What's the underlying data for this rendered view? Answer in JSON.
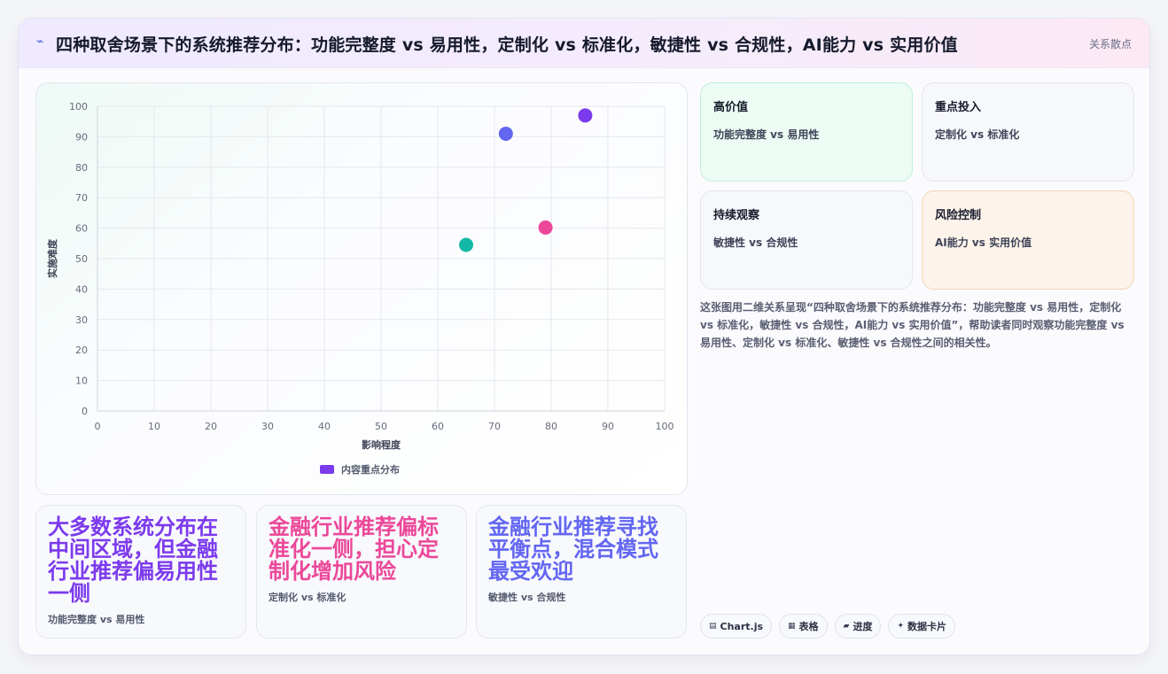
{
  "header": {
    "icon": "flash-icon",
    "title": "四种取舍场景下的系统推荐分布：功能完整度 vs 易用性，定制化 vs 标准化，敏捷性 vs 合规性，AI能力 vs 实用价值",
    "tag": "关系散点"
  },
  "chart_data": {
    "type": "scatter",
    "xlabel": "影响程度",
    "ylabel": "实施难度",
    "xlim": [
      0,
      100
    ],
    "ylim": [
      0,
      100
    ],
    "xticks": [
      "0",
      "10",
      "20",
      "30",
      "40",
      "50",
      "60",
      "70",
      "80",
      "90",
      "100"
    ],
    "yticks": [
      "0",
      "10",
      "20",
      "30",
      "40",
      "50",
      "60",
      "70",
      "80",
      "90",
      "100"
    ],
    "grid": true,
    "legend_position": "bottom",
    "series": [
      {
        "name": "内容重点分布",
        "legend_color": "#7c3aed",
        "points": [
          {
            "x": 72,
            "y": 91,
            "color": "#6366f1"
          },
          {
            "x": 86,
            "y": 97,
            "color": "#7c3aed"
          },
          {
            "x": 65,
            "y": 54.5,
            "color": "#14b8a6"
          },
          {
            "x": 79,
            "y": 60.2,
            "color": "#ec4899"
          }
        ]
      }
    ]
  },
  "side_cards": [
    {
      "label": "高价值",
      "value": "功能完整度 vs 易用性"
    },
    {
      "label": "重点投入",
      "value": "定制化 vs 标准化"
    },
    {
      "label": "持续观察",
      "value": "敏捷性 vs 合规性"
    },
    {
      "label": "风险控制",
      "value": "AI能力 vs 实用价值"
    }
  ],
  "description": "这张图用二维关系呈现“四种取舍场景下的系统推荐分布：功能完整度 vs 易用性，定制化 vs 标准化，敏捷性 vs 合规性，AI能力 vs 实用价值”，帮助读者同时观察功能完整度 vs 易用性、定制化 vs 标准化、敏捷性 vs 合规性之间的相关性。",
  "insights": [
    {
      "headline": "大多数系统分布在中间区域，但金融行业推荐偏易用性一侧",
      "sub": "功能完整度 vs 易用性",
      "color": "#7c3aed"
    },
    {
      "headline": "金融行业推荐偏标准化一侧，担心定制化增加风险",
      "sub": "定制化 vs 标准化",
      "color": "#ec4899"
    },
    {
      "headline": "金融行业推荐寻找平衡点，混合模式最受欢迎",
      "sub": "敏捷性 vs 合规性",
      "color": "#6366f1"
    }
  ],
  "chips": [
    {
      "icon": "▤",
      "label": "Chart.js"
    },
    {
      "icon": "▦",
      "label": "表格"
    },
    {
      "icon": "▰",
      "label": "进度"
    },
    {
      "icon": "✦",
      "label": "数据卡片"
    }
  ]
}
